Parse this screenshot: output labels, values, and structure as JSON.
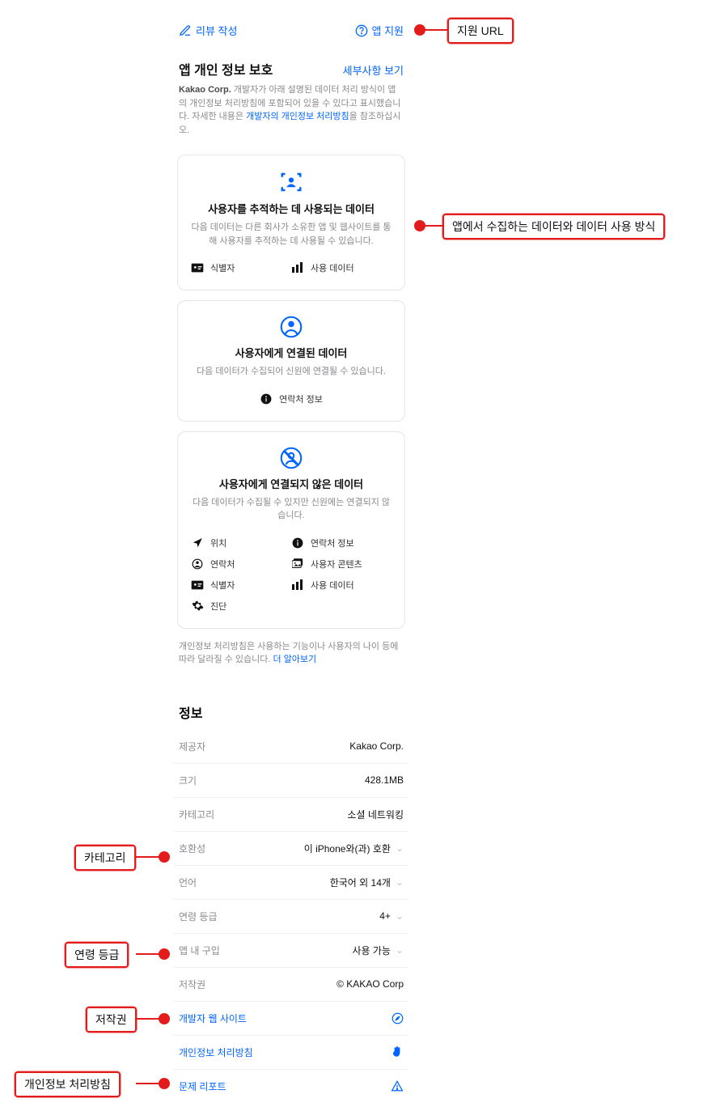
{
  "top": {
    "review_label": "리뷰 작성",
    "support_label": "앱 지원"
  },
  "privacy": {
    "title": "앱 개인 정보 보호",
    "details_link": "세부사항 보기",
    "desc_bold": "Kakao Corp.",
    "desc_1": " 개발자가 아래 설명된 데이터 처리 방식이 앱의 개인정보 처리방침에 포함되어 있을 수 있다고 표시했습니다. 자세한 내용은 ",
    "desc_link": "개발자의 개인정보 처리방침",
    "desc_2": "을 참조하십시오.",
    "cards": {
      "track": {
        "title": "사용자를 추적하는 데 사용되는 데이터",
        "body": "다음 데이터는 다른 회사가 소유한 앱 및 웹사이트를 통해 사용자를 추적하는 데 사용될 수 있습니다.",
        "items": [
          {
            "icon": "id",
            "label": "식별자"
          },
          {
            "icon": "chart",
            "label": "사용 데이터"
          }
        ]
      },
      "linked": {
        "title": "사용자에게 연결된 데이터",
        "body": "다음 데이터가 수집되어 신원에 연결될 수 있습니다.",
        "items": [
          {
            "icon": "info",
            "label": "연락처 정보"
          }
        ]
      },
      "unlinked": {
        "title": "사용자에게 연결되지 않은 데이터",
        "body": "다음 데이터가 수집될 수 있지만 신원에는 연결되지 않습니다.",
        "items": [
          {
            "icon": "loc",
            "label": "위치"
          },
          {
            "icon": "info",
            "label": "연락처 정보"
          },
          {
            "icon": "user",
            "label": "연락처"
          },
          {
            "icon": "media",
            "label": "사용자 콘텐츠"
          },
          {
            "icon": "id",
            "label": "식별자"
          },
          {
            "icon": "chart",
            "label": "사용 데이터"
          },
          {
            "icon": "gear",
            "label": "진단"
          }
        ]
      }
    },
    "footer_1": "개인정보 처리방침은 사용하는 기능이나 사용자의 나이 등에 따라 달라질 수 있습니다. ",
    "footer_link": "더 알아보기"
  },
  "info": {
    "heading": "정보",
    "rows": [
      {
        "label": "제공자",
        "value": "Kakao Corp.",
        "chev": false
      },
      {
        "label": "크기",
        "value": "428.1MB",
        "chev": false
      },
      {
        "label": "카테고리",
        "value": "소셜 네트워킹",
        "chev": false
      },
      {
        "label": "호환성",
        "value": "이 iPhone와(과) 호환",
        "chev": true
      },
      {
        "label": "언어",
        "value": "한국어 외 14개",
        "chev": true
      },
      {
        "label": "연령 등급",
        "value": "4+",
        "chev": true
      },
      {
        "label": "앱 내 구입",
        "value": "사용 가능",
        "chev": true
      },
      {
        "label": "저작권",
        "value": "© KAKAO Corp",
        "chev": false
      }
    ],
    "link_rows": [
      {
        "label": "개발자 웹 사이트",
        "icon": "compass"
      },
      {
        "label": "개인정보 처리방침",
        "icon": "hand"
      },
      {
        "label": "문제 리포트",
        "icon": "warn"
      }
    ]
  },
  "annotations": {
    "support_url": "지원 URL",
    "data_usage": "앱에서 수집하는 데이터와 데이터 사용 방식",
    "category": "카테고리",
    "age": "연령 등급",
    "copyright": "저작권",
    "privacy_policy": "개인정보 처리방침"
  }
}
